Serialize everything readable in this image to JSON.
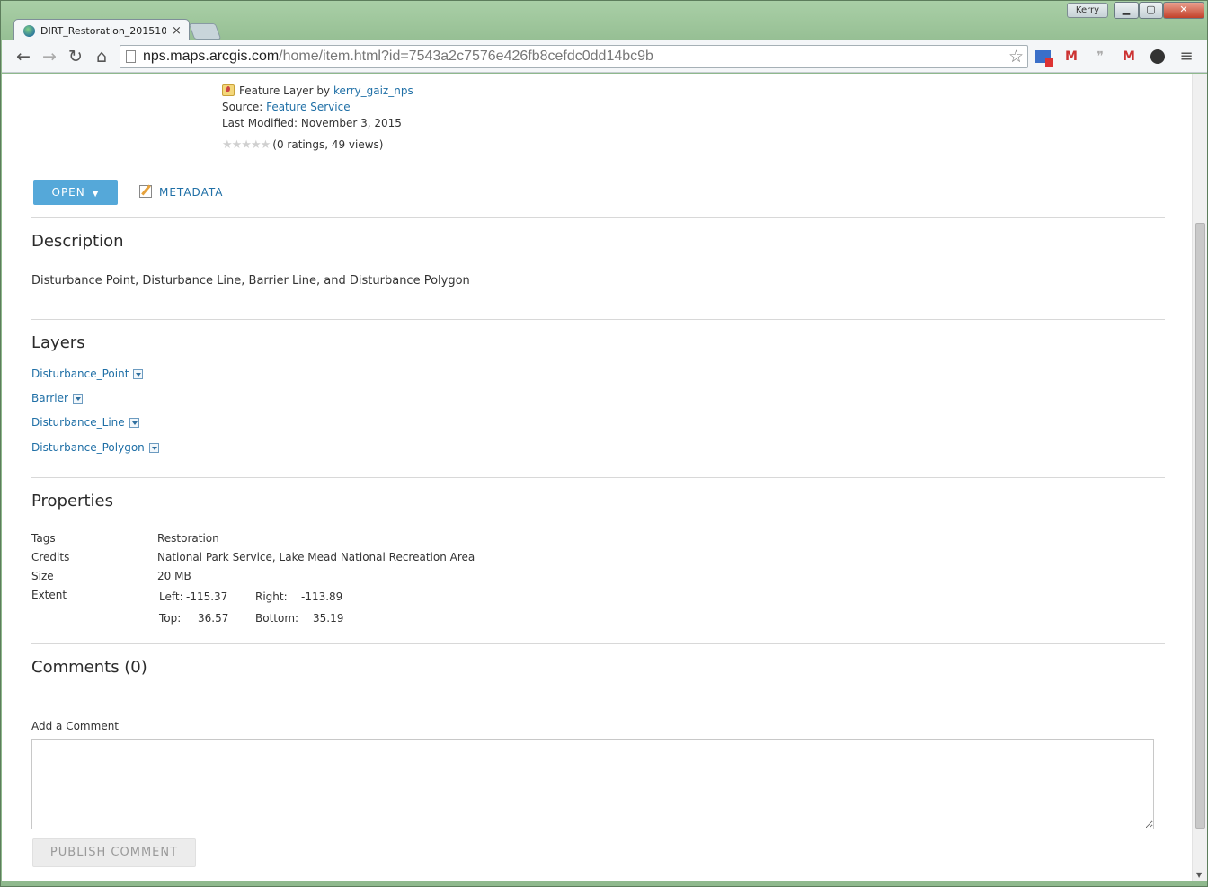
{
  "browser": {
    "tab_title": "DIRT_Restoration_201510",
    "tab_close": "×",
    "profile_name": "Kerry",
    "url_host": "nps.maps.arcgis.com",
    "url_path": "/home/item.html?id=7543a2c7576e426fb8cefdc0dd14bc9b",
    "back": "←",
    "forward": "→",
    "reload": "↻",
    "home": "⌂",
    "menu": "≡",
    "star": "☆",
    "min": "▁",
    "max": "▢",
    "close": "✕"
  },
  "item": {
    "type_prefix": "Feature Layer by ",
    "owner": "kerry_gaiz_nps",
    "source_label": "Source: ",
    "source_value": "Feature Service",
    "modified_label": "Last Modified: ",
    "modified_value": "November 3, 2015",
    "stars": "★★★★★",
    "ratings_text": "(0 ratings, 49 views)"
  },
  "actions": {
    "open_label": "OPEN",
    "open_caret": "▼",
    "metadata_label": "METADATA"
  },
  "description": {
    "title": "Description",
    "text": "Disturbance Point, Disturbance Line, Barrier Line, and Disturbance Polygon"
  },
  "layers": {
    "title": "Layers",
    "items": [
      {
        "label": "Disturbance_Point"
      },
      {
        "label": "Barrier"
      },
      {
        "label": "Disturbance_Line"
      },
      {
        "label": "Disturbance_Polygon"
      }
    ]
  },
  "properties": {
    "title": "Properties",
    "tags_label": "Tags",
    "tags_value": "Restoration",
    "credits_label": "Credits",
    "credits_value": "National Park Service, Lake Mead National Recreation Area",
    "size_label": "Size",
    "size_value": "20 MB",
    "extent_label": "Extent",
    "extent": {
      "left_label": "Left:",
      "left_value": "-115.37",
      "right_label": "Right:",
      "right_value": "-113.89",
      "top_label": "Top:",
      "top_value": "36.57",
      "bottom_label": "Bottom:",
      "bottom_value": "35.19"
    }
  },
  "comments": {
    "title": "Comments (0)",
    "add_label": "Add a Comment",
    "publish_label": "PUBLISH COMMENT"
  },
  "colors": {
    "accent": "#55a8d9",
    "link": "#1f6fa6",
    "window_frame": "#8fb98d"
  }
}
